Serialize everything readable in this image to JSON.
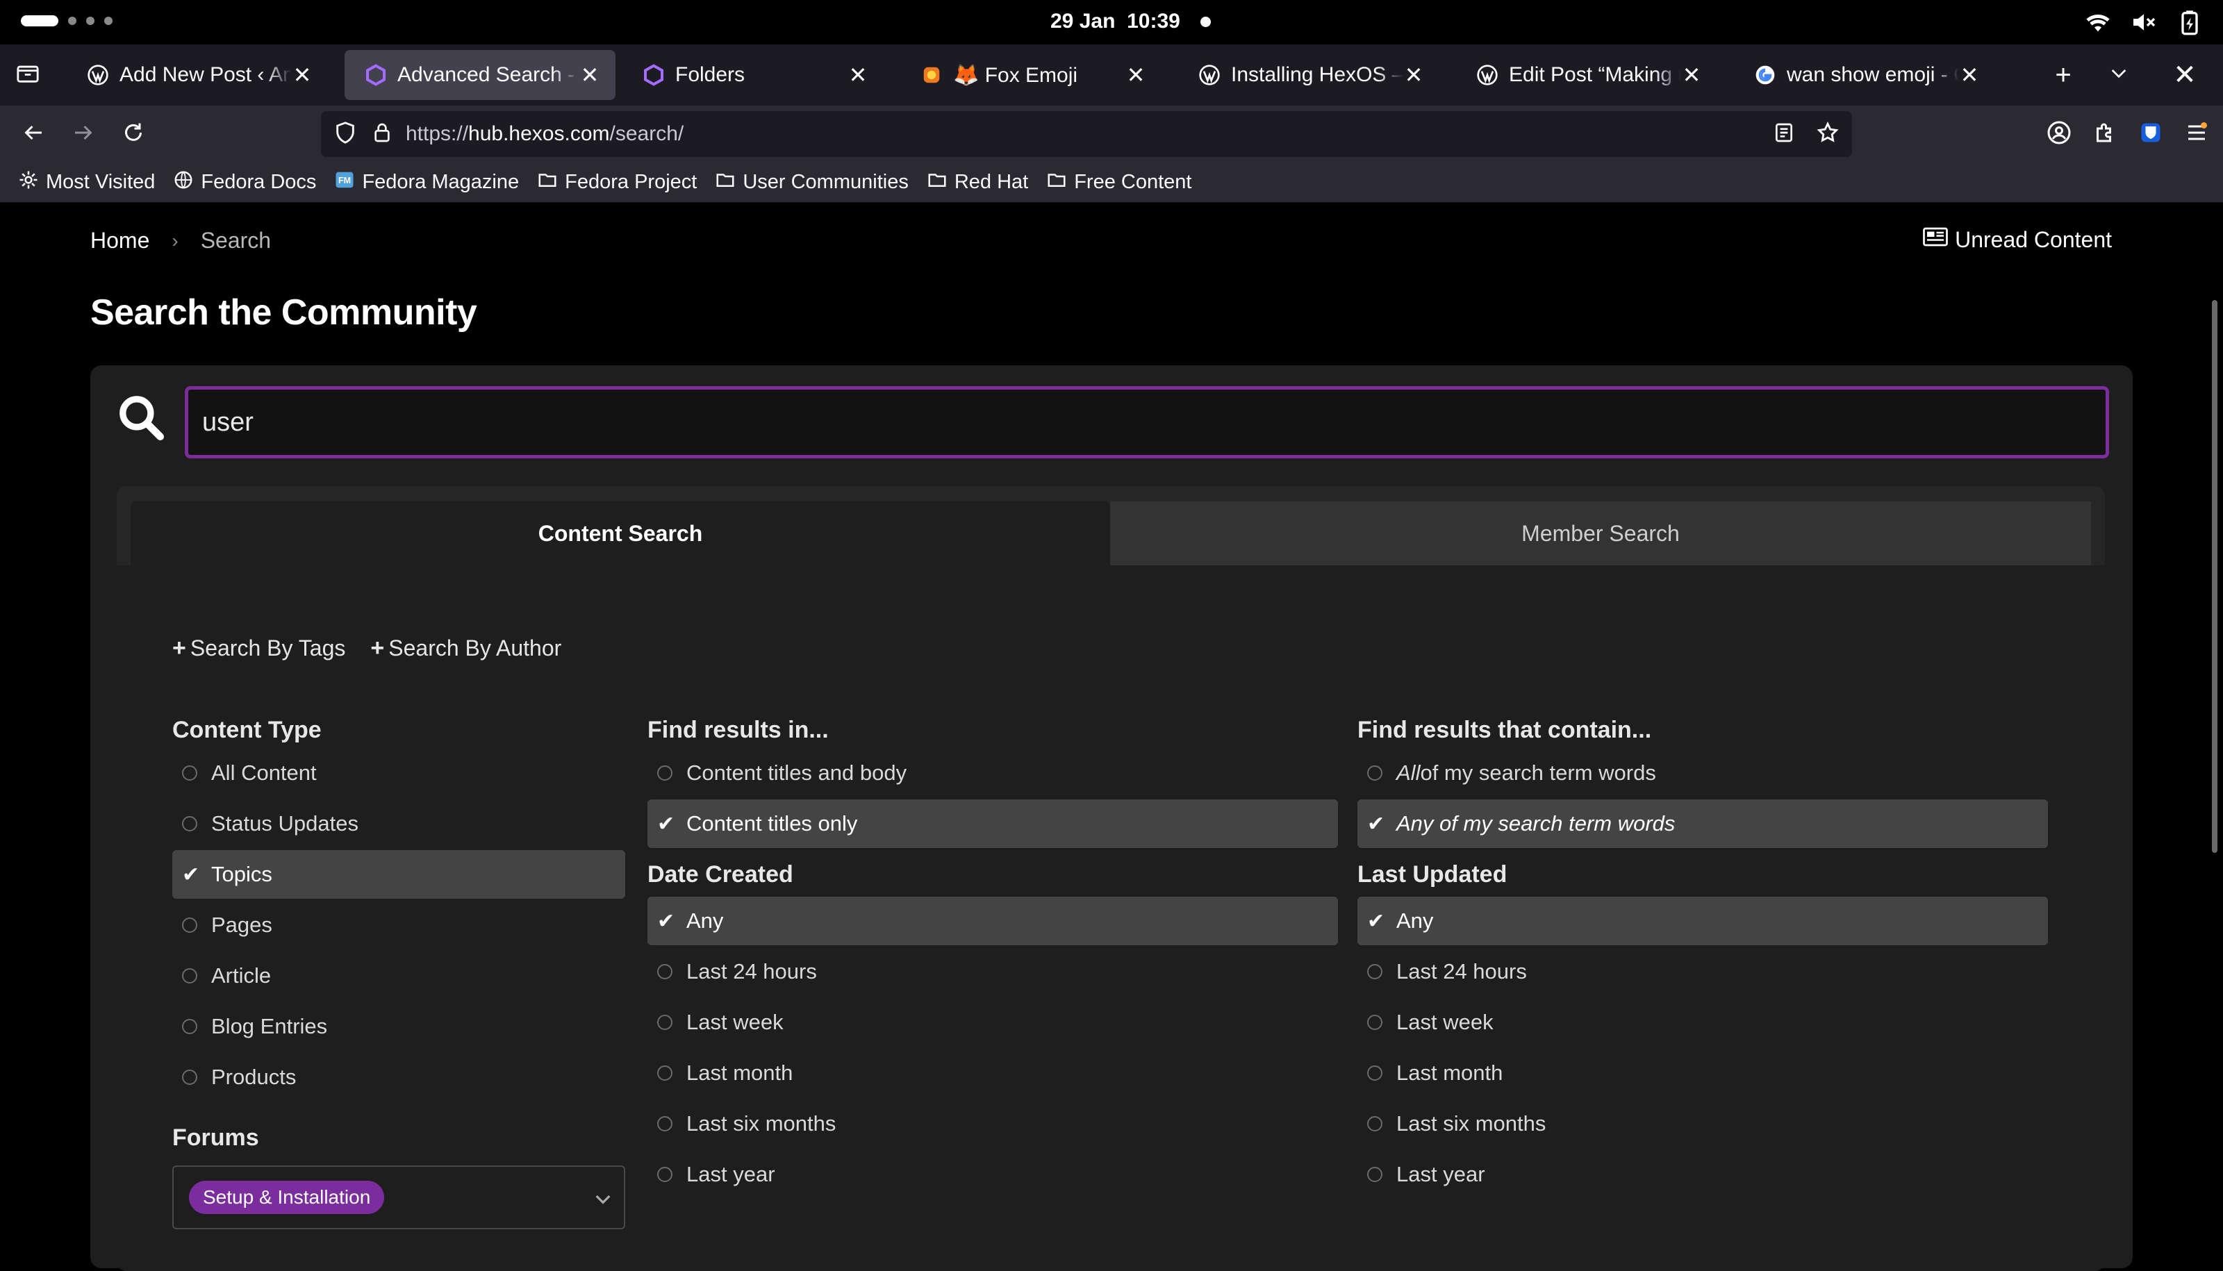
{
  "system": {
    "date": "29 Jan",
    "time": "10:39"
  },
  "tabs": [
    {
      "title": "Add New Post ‹ Anna",
      "icon": "wordpress-icon"
    },
    {
      "title": "Advanced Search - HexOS",
      "icon": "hexos-icon",
      "active": true
    },
    {
      "title": "Folders",
      "icon": "hexos-icon"
    },
    {
      "title": "🦊 Fox Emoji",
      "icon": "emoji-site-icon"
    },
    {
      "title": "Installing HexOS – Anna",
      "icon": "wordpress-icon"
    },
    {
      "title": "Edit Post “Making my",
      "icon": "wordpress-icon"
    },
    {
      "title": "wan show emoji - Google",
      "icon": "google-icon"
    }
  ],
  "url": {
    "prefix": "https://",
    "host": "hub.hexos.com",
    "path": "/search/"
  },
  "bookmarks": [
    {
      "label": "Most Visited",
      "icon": "gear-icon"
    },
    {
      "label": "Fedora Docs",
      "icon": "globe-icon"
    },
    {
      "label": "Fedora Magazine",
      "icon": "fedora-magazine-icon"
    },
    {
      "label": "Fedora Project",
      "icon": "folder-icon"
    },
    {
      "label": "User Communities",
      "icon": "folder-icon"
    },
    {
      "label": "Red Hat",
      "icon": "folder-icon"
    },
    {
      "label": "Free Content",
      "icon": "folder-icon"
    }
  ],
  "breadcrumb": {
    "home": "Home",
    "sep": "›",
    "current": "Search"
  },
  "unread_label": "Unread Content",
  "page_title": "Search the Community",
  "search": {
    "value": "user"
  },
  "panel_tabs": {
    "content": "Content Search",
    "member": "Member Search"
  },
  "adders": {
    "tags": "Search By Tags",
    "author": "Search By Author"
  },
  "content_type": {
    "heading": "Content Type",
    "options": [
      {
        "label": "All Content",
        "selected": false
      },
      {
        "label": "Status Updates",
        "selected": false
      },
      {
        "label": "Topics",
        "selected": true
      },
      {
        "label": "Pages",
        "selected": false
      },
      {
        "label": "Article",
        "selected": false
      },
      {
        "label": "Blog Entries",
        "selected": false
      },
      {
        "label": "Products",
        "selected": false
      }
    ]
  },
  "forums": {
    "heading": "Forums",
    "chip": "Setup & Installation"
  },
  "find_in": {
    "heading": "Find results in...",
    "options": [
      {
        "label": "Content titles and body",
        "selected": false
      },
      {
        "label": "Content titles only",
        "selected": true
      }
    ]
  },
  "contain": {
    "heading": "Find results that contain...",
    "options": [
      {
        "em": "All",
        "rest": " of my search term words",
        "selected": false
      },
      {
        "em": "Any of my search term words",
        "rest": "",
        "selected": true
      }
    ]
  },
  "date_created": {
    "heading": "Date Created",
    "options": [
      {
        "label": "Any",
        "selected": true
      },
      {
        "label": "Last 24 hours",
        "selected": false
      },
      {
        "label": "Last week",
        "selected": false
      },
      {
        "label": "Last month",
        "selected": false
      },
      {
        "label": "Last six months",
        "selected": false
      },
      {
        "label": "Last year",
        "selected": false
      }
    ]
  },
  "last_updated": {
    "heading": "Last Updated",
    "options": [
      {
        "label": "Any",
        "selected": true
      },
      {
        "label": "Last 24 hours",
        "selected": false
      },
      {
        "label": "Last week",
        "selected": false
      },
      {
        "label": "Last month",
        "selected": false
      },
      {
        "label": "Last six months",
        "selected": false
      },
      {
        "label": "Last year",
        "selected": false
      }
    ]
  },
  "colors": {
    "accent": "#7b2d9e",
    "selected_row": "#444444",
    "panel": "#1e1e1e"
  }
}
